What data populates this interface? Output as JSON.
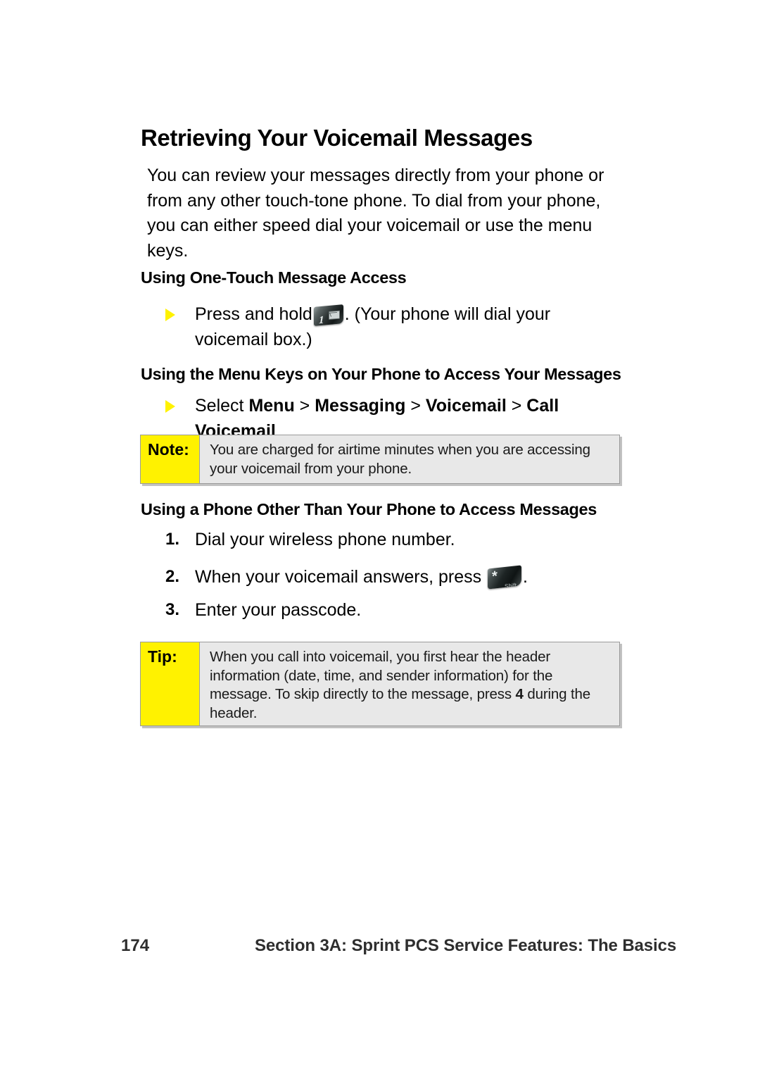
{
  "page": {
    "title": "Retrieving Your Voicemail Messages",
    "intro": "You can review your messages directly from your phone or from any other touch-tone phone. To dial from your phone, you can either speed dial your voicemail or use the menu keys."
  },
  "sections": {
    "one_touch": {
      "heading": "Using One-Touch Message Access",
      "bullet_before_key": "Press and hold",
      "bullet_after_key": ". (Your phone will dial your voicemail box.)",
      "key_icon": "phone-key-1-voicemail",
      "key_label": "1"
    },
    "menu_keys": {
      "heading": "Using the Menu Keys on Your Phone to Access Your Messages",
      "bullet_prefix": "Select ",
      "path": [
        "Menu",
        "Messaging",
        "Voicemail",
        "Call Voicemail"
      ],
      "separator": " > ",
      "bullet_suffix": "."
    },
    "other_phone": {
      "heading": "Using a Phone Other Than Your Phone to Access Messages",
      "steps": [
        {
          "number": "1.",
          "text": "Dial your wireless phone number."
        },
        {
          "number": "2.",
          "text_before_key": "When your voicemail answers, press",
          "text_after_key": ".",
          "key_icon": "phone-key-star-shift",
          "key_label": "*",
          "key_sublabel": "Shift"
        },
        {
          "number": "3.",
          "text": "Enter your passcode."
        }
      ]
    }
  },
  "callouts": {
    "note": {
      "label": "Note:",
      "body": "You are charged for airtime minutes when you are accessing your voicemail from your phone."
    },
    "tip": {
      "label": "Tip:",
      "body_part1": "When you call into voicemail, you first hear the header information (date, time, and sender information) for the message. To skip directly to the message, press ",
      "body_bold": "4",
      "body_part2": " during the header."
    }
  },
  "footer": {
    "page_number": "174",
    "section_text": "Section 3A: Sprint PCS Service Features: The Basics"
  },
  "colors": {
    "callout_label_yellow": "#FFF200",
    "callout_body_gray": "#E8E8E8",
    "callout_border": "#9A9A9A",
    "bullet_yellow": "#FFF200",
    "footer_text": "#2E2E2E"
  }
}
